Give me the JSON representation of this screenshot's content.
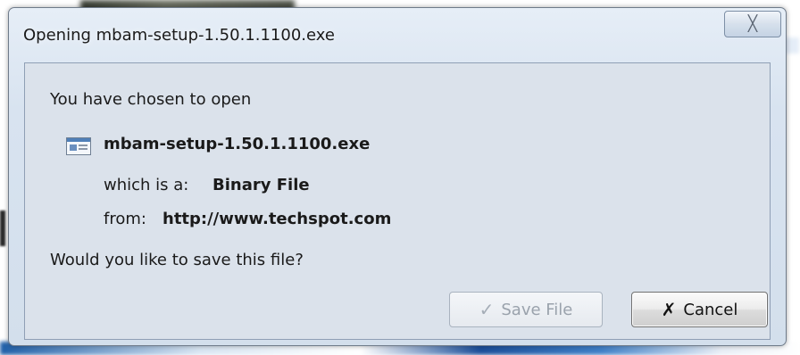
{
  "dialog": {
    "title": "Opening mbam-setup-1.50.1.1100.exe",
    "close_glyph": "╳",
    "intro": "You have chosen to open",
    "file": {
      "icon": "executable-file-icon",
      "name": "mbam-setup-1.50.1.1100.exe",
      "type_label": "which is a:",
      "type_value": "Binary File",
      "from_label": "from:",
      "from_value": "http://www.techspot.com"
    },
    "question": "Would you like to save this file?",
    "buttons": {
      "save": {
        "icon": "checkmark-icon",
        "glyph": "✓",
        "label": "Save File",
        "disabled": true
      },
      "cancel": {
        "icon": "x-mark-icon",
        "glyph": "✗",
        "label": "Cancel",
        "disabled": false
      }
    }
  },
  "colors": {
    "frame": "#d8e3f0",
    "client": "#dbe2eb",
    "disabled_text": "#9aa2ac"
  }
}
